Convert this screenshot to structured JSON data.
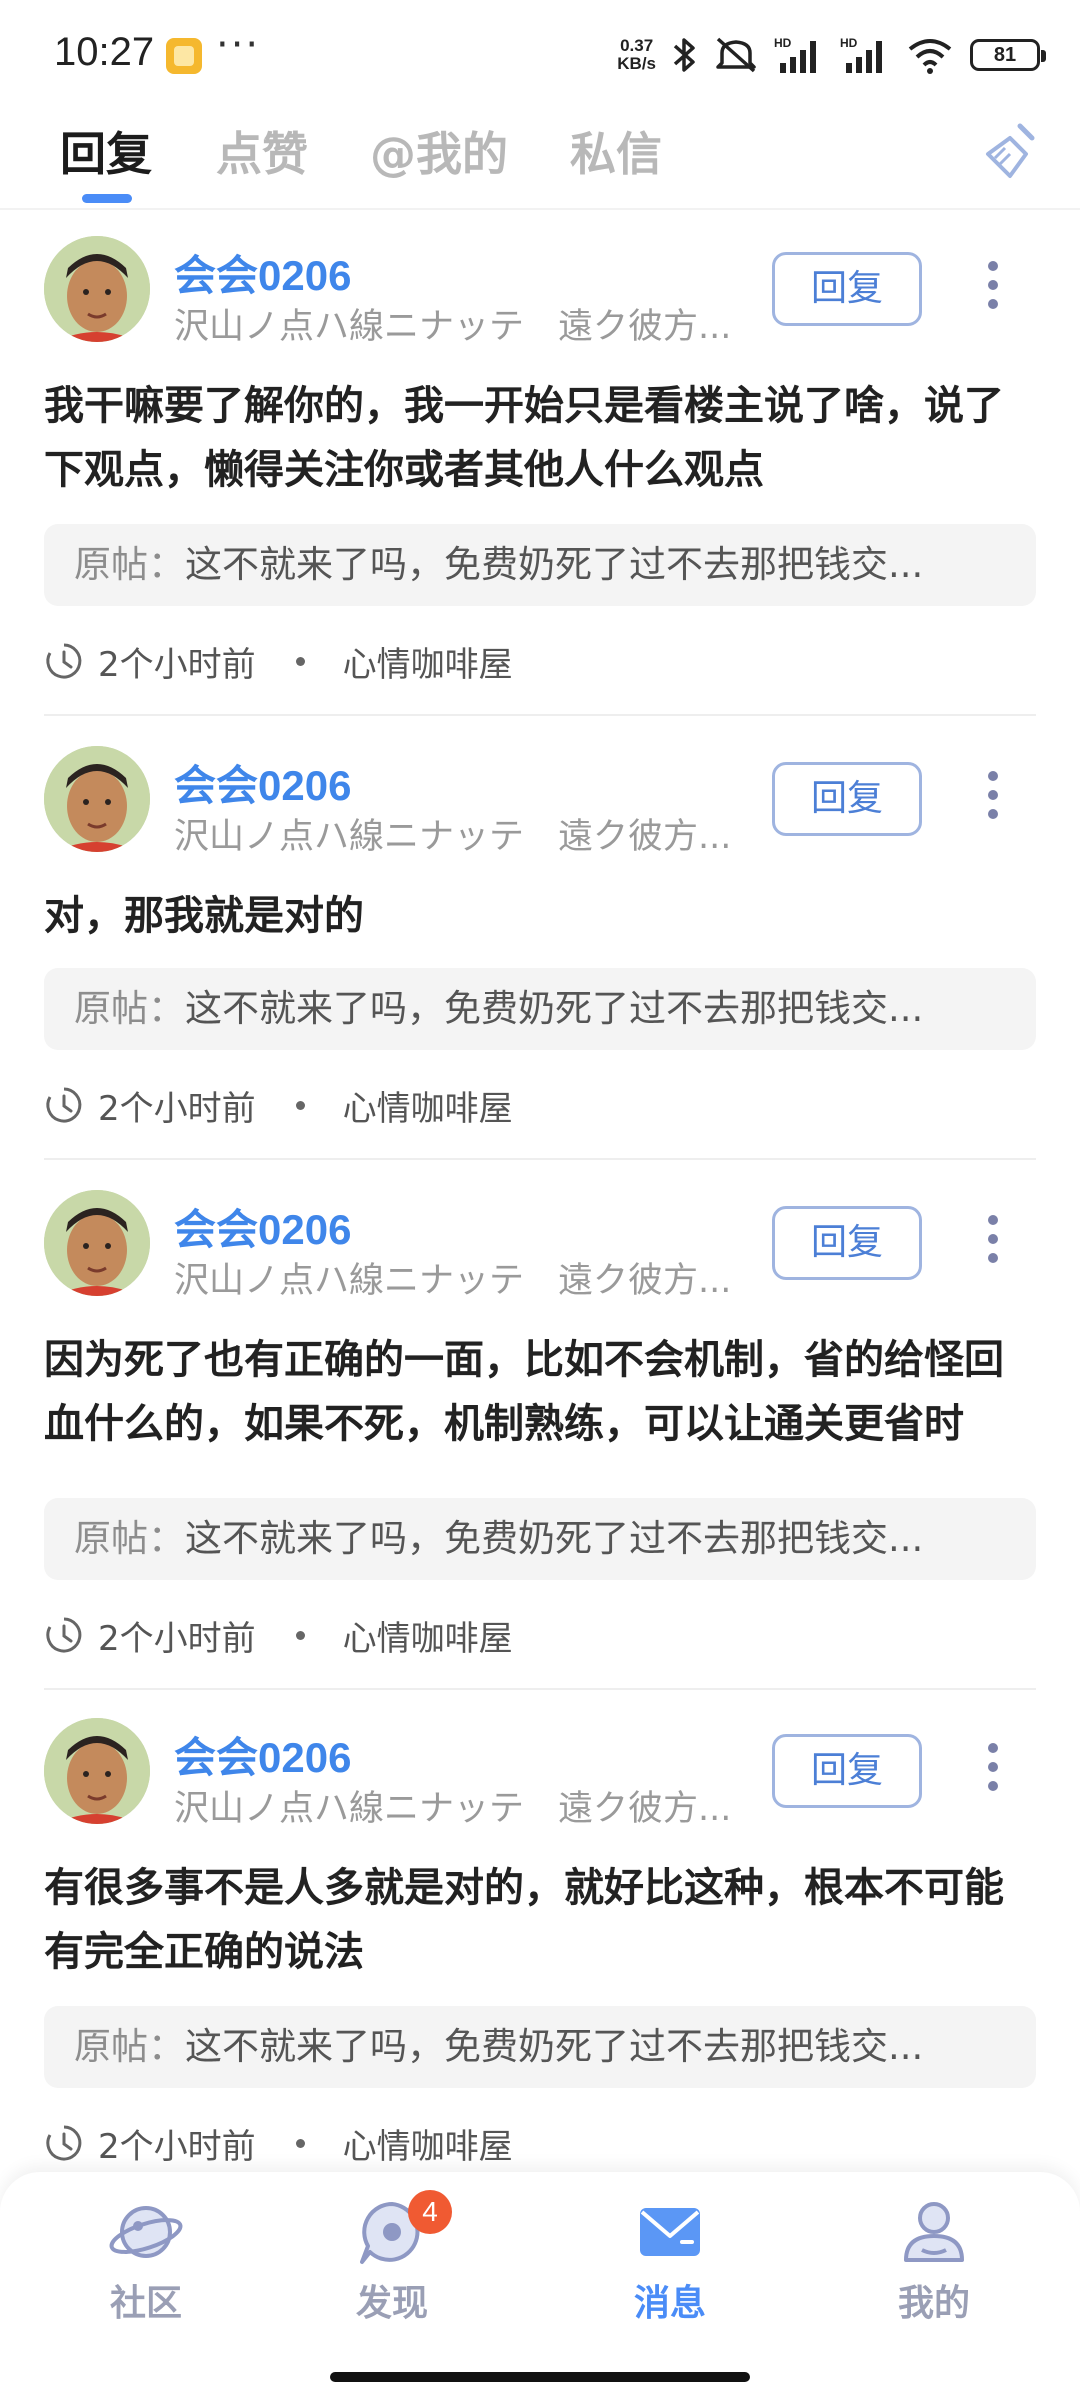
{
  "status_bar": {
    "time": "10:27",
    "more": "···",
    "net_speed_value": "0.37",
    "net_speed_unit": "KB/s",
    "battery": "81",
    "icons": [
      "notification-app-icon",
      "bluetooth-icon",
      "mute-icon",
      "signal-icon",
      "wifi-icon",
      "battery-icon"
    ]
  },
  "tabs": [
    {
      "label": "回复",
      "active": true
    },
    {
      "label": "点赞",
      "active": false
    },
    {
      "label": "@我的",
      "active": false
    },
    {
      "label": "私信",
      "active": false
    }
  ],
  "accent_color": "#4a8cf7",
  "items": [
    {
      "user": "会会0206",
      "signature": "沢山ノ点ハ線ニナッテ",
      "signature2": "遠ク彼方...",
      "reply_label": "回复",
      "content": "我干嘛要了解你的，我一开始只是看楼主说了啥，说了下观点，懒得关注你或者其他人什么观点",
      "orig_label": "原帖：",
      "orig_text": "这不就来了吗，免费奶死了过不去那把钱交...",
      "time": "2个小时前",
      "forum": "心情咖啡屋"
    },
    {
      "user": "会会0206",
      "signature": "沢山ノ点ハ線ニナッテ",
      "signature2": "遠ク彼方...",
      "reply_label": "回复",
      "content": "对，那我就是对的",
      "orig_label": "原帖：",
      "orig_text": "这不就来了吗，免费奶死了过不去那把钱交...",
      "time": "2个小时前",
      "forum": "心情咖啡屋"
    },
    {
      "user": "会会0206",
      "signature": "沢山ノ点ハ線ニナッテ",
      "signature2": "遠ク彼方...",
      "reply_label": "回复",
      "content": "因为死了也有正确的一面，比如不会机制，省的给怪回血什么的，如果不死，机制熟练，可以让通关更省时",
      "orig_label": "原帖：",
      "orig_text": "这不就来了吗，免费奶死了过不去那把钱交...",
      "time": "2个小时前",
      "forum": "心情咖啡屋"
    },
    {
      "user": "会会0206",
      "signature": "沢山ノ点ハ線ニナッテ",
      "signature2": "遠ク彼方...",
      "reply_label": "回复",
      "content": "有很多事不是人多就是对的，就好比这种，根本不可能有完全正确的说法",
      "orig_label": "原帖：",
      "orig_text": "这不就来了吗，免费奶死了过不去那把钱交...",
      "time": "2个小时前",
      "forum": "心情咖啡屋"
    }
  ],
  "bottom_nav": [
    {
      "label": "社区",
      "icon": "planet-icon",
      "active": false
    },
    {
      "label": "发现",
      "icon": "discover-icon",
      "active": false,
      "badge": "4"
    },
    {
      "label": "消息",
      "icon": "mail-icon",
      "active": true
    },
    {
      "label": "我的",
      "icon": "profile-icon",
      "active": false
    }
  ]
}
